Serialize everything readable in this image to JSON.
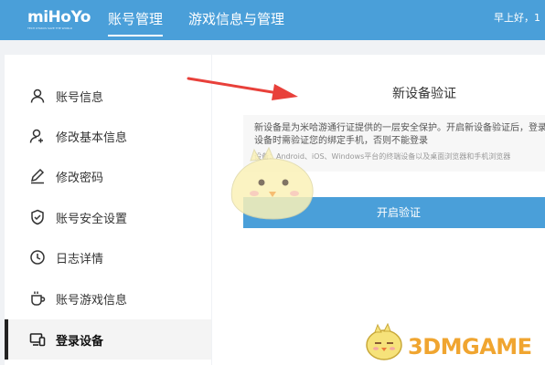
{
  "brand": {
    "logo": "miHoYo",
    "tagline": "TECH OTAKUS SAVE THE WORLD"
  },
  "nav": {
    "tabs": [
      {
        "label": "账号管理",
        "active": true
      },
      {
        "label": "游戏信息与管理",
        "active": false
      }
    ],
    "greeting": "早上好，1"
  },
  "sidebar": {
    "items": [
      {
        "label": "账号信息",
        "icon": "user-icon"
      },
      {
        "label": "修改基本信息",
        "icon": "user-edit-icon"
      },
      {
        "label": "修改密码",
        "icon": "pencil-icon"
      },
      {
        "label": "账号安全设置",
        "icon": "shield-check-icon"
      },
      {
        "label": "日志详情",
        "icon": "clock-icon"
      },
      {
        "label": "账号游戏信息",
        "icon": "cup-icon"
      },
      {
        "label": "登录设备",
        "icon": "devices-icon",
        "active": true
      }
    ]
  },
  "panel": {
    "title": "新设备验证",
    "description": "新设备是为米哈游通行证提供的一层安全保护。开启新设备验证后，登录新设备时需验证您的绑定手机，否则不能登录",
    "devices_note": "设备：Android、iOS、Windows平台的终端设备以及桌面浏览器和手机浏览器",
    "button_label": "开启验证"
  },
  "watermark": {
    "text": "3DMGAME"
  },
  "colors": {
    "accent": "#4a9fd9",
    "arrow": "#e8403a",
    "watermark": "#f0a530"
  }
}
